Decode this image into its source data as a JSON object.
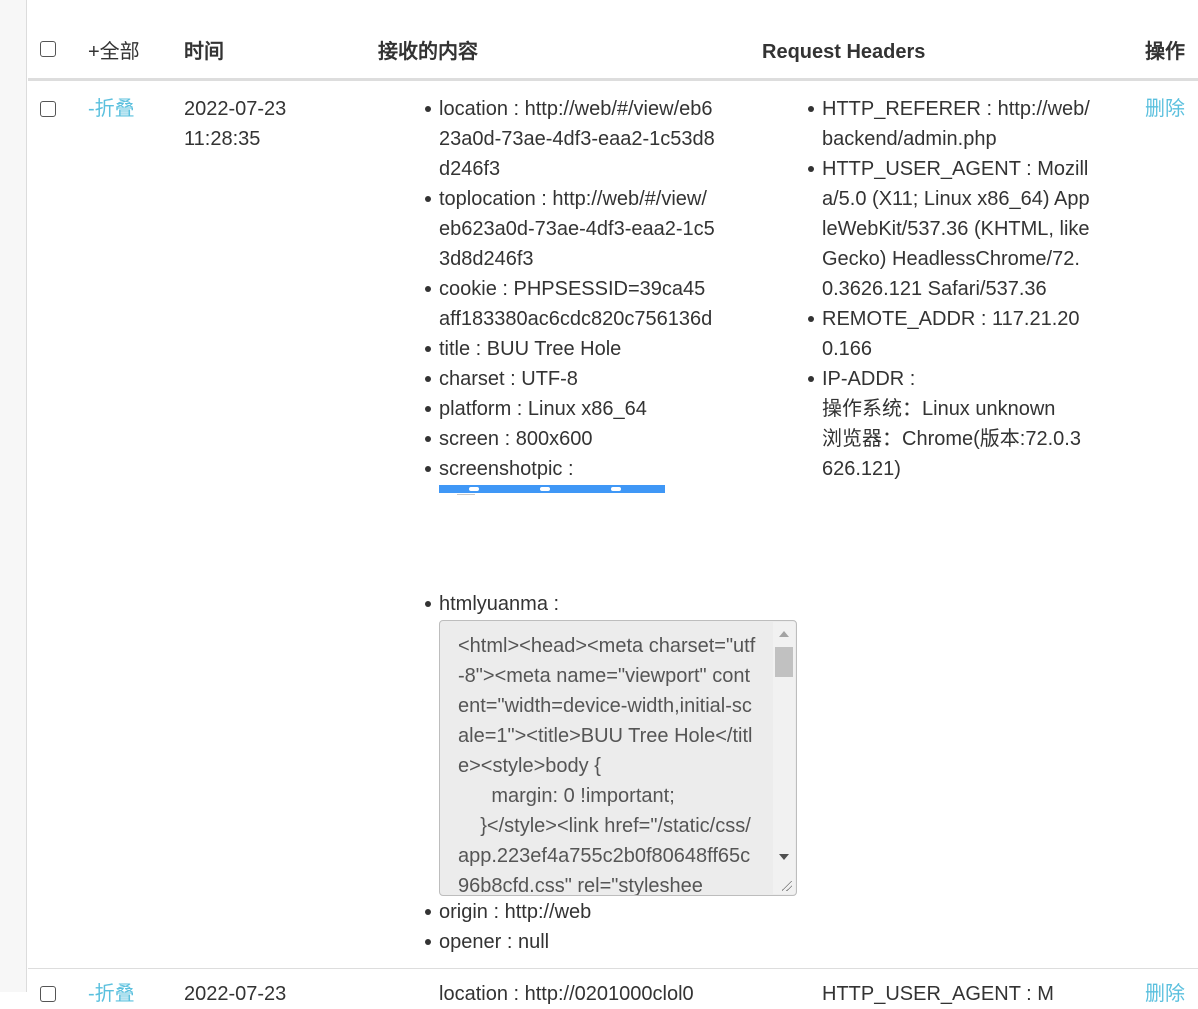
{
  "header": {
    "expand_all": "+全部",
    "time": "时间",
    "content": "接收的内容",
    "request_headers": "Request Headers",
    "actions": "操作"
  },
  "row1": {
    "collapse": "-折叠",
    "date": "2022-07-23",
    "time": "11:28:35",
    "content": {
      "location": "location : http://web/#/view/eb623a0d-73ae-4df3-eaa2-1c53d8d246f3",
      "toplocation": "toplocation : http://web/#/view/eb623a0d-73ae-4df3-eaa2-1c53d8d246f3",
      "cookie": "cookie : PHPSESSID=39ca45aff183380ac6cdc820c756136d",
      "title": "title : BUU Tree Hole",
      "charset": "charset : UTF-8",
      "platform": "platform : Linux x86_64",
      "screen": "screen : 800x600",
      "screenshotpic": "screenshotpic :",
      "htmlyuanma": "htmlyuanma :",
      "htmlyuanma_value": "<html><head><meta charset=\"utf-8\"><meta name=\"viewport\" content=\"width=device-width,initial-scale=1\"><title>BUU Tree Hole</title><style>body {\n      margin: 0 !important;\n    }</style><link href=\"/static/css/app.223ef4a755c2b0f80648ff65c96b8cfd.css\" rel=\"styleshee",
      "origin": "origin : http://web",
      "opener": "opener : null"
    },
    "headers": {
      "referer": "HTTP_REFERER : http://web/backend/admin.php",
      "user_agent": "HTTP_USER_AGENT : Mozilla/5.0 (X11; Linux x86_64) AppleWebKit/537.36 (KHTML, like Gecko) HeadlessChrome/72.0.3626.121 Safari/537.36",
      "remote_addr": "REMOTE_ADDR : 117.21.200.166",
      "ip_addr_label": "IP-ADDR :",
      "os": "操作系统：Linux unknown",
      "browser": "浏览器：Chrome(版本:72.0.3626.121)"
    },
    "delete": "删除"
  },
  "row2": {
    "collapse": "-折叠",
    "date": "2022-07-23",
    "content_first": "location : http://0201000clol0",
    "headers_first": "HTTP_USER_AGENT : M",
    "delete": "删除"
  },
  "colors": {
    "link": "#5bc0de",
    "screenshot_bar": "#3f97f6"
  }
}
